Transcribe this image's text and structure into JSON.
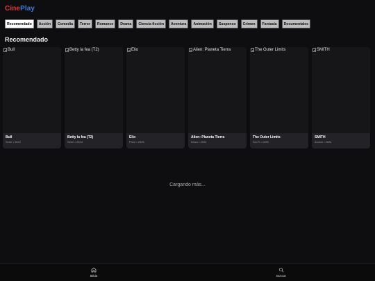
{
  "app": {
    "logo_part1": "Cine",
    "logo_part2": "Play"
  },
  "categories": [
    "Recomendado",
    "Acción",
    "Comedia",
    "Terror",
    "Romance",
    "Drama",
    "Ciencia ficción",
    "Aventura",
    "Animación",
    "Suspenso",
    "Crimen",
    "Fantasía",
    "Documentales"
  ],
  "section_title": "Recomendado",
  "cards": [
    {
      "alt": "Bull",
      "title": "Bull",
      "sub": "Serie • 2022"
    },
    {
      "alt": "Betty la fea (T2)",
      "title": "Betty la fea (T2)",
      "sub": "Serie • 2024"
    },
    {
      "alt": "Elio",
      "title": "Elio",
      "sub": "Pixar • 2025"
    },
    {
      "alt": "Alien: Planeta Tierra",
      "title": "Alien: Planeta Tierra",
      "sub": "Disco • 2024"
    },
    {
      "alt": "The Outer Limits",
      "title": "The Outer Limits",
      "sub": "Sci-Fi • 1995"
    },
    {
      "alt": "SMITH",
      "title": "SMITH",
      "sub": "Acción • 2024"
    }
  ],
  "loading_text": "Cargando más...",
  "bottom_nav": {
    "home_label": "Inicio",
    "search_label": "Buscar"
  },
  "colors": {
    "accent_red": "#e53935",
    "accent_blue": "#3b7bd8",
    "background": "#0e0e10"
  },
  "icons": {
    "home": "home-icon",
    "search": "search-icon",
    "broken_image": "broken-image-icon"
  }
}
